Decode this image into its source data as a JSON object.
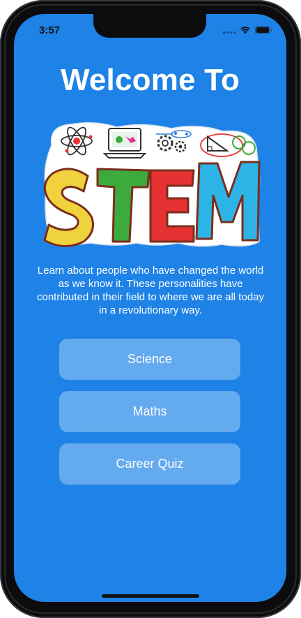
{
  "status_bar": {
    "time": "3:57",
    "icons": [
      "signal-icon",
      "wifi-icon",
      "battery-icon"
    ]
  },
  "main": {
    "title": "Welcome To",
    "logo": {
      "text": "STEM",
      "icons": [
        "atom-icon",
        "laptop-icon",
        "gears-icon",
        "geometry-icon"
      ]
    },
    "description": "Learn about people who have changed the world as we know it. These personalities have contributed in their field to where we are all today in a revolutionary way.",
    "buttons": [
      {
        "label": "Science"
      },
      {
        "label": "Maths"
      },
      {
        "label": "Career Quiz"
      }
    ]
  },
  "colors": {
    "background": "#1e82e6",
    "button": "#64aaef",
    "text": "#ffffff",
    "stem_s": "#f0d23c",
    "stem_t": "#3caa3c",
    "stem_e": "#e63232",
    "stem_m": "#2db4e6"
  }
}
